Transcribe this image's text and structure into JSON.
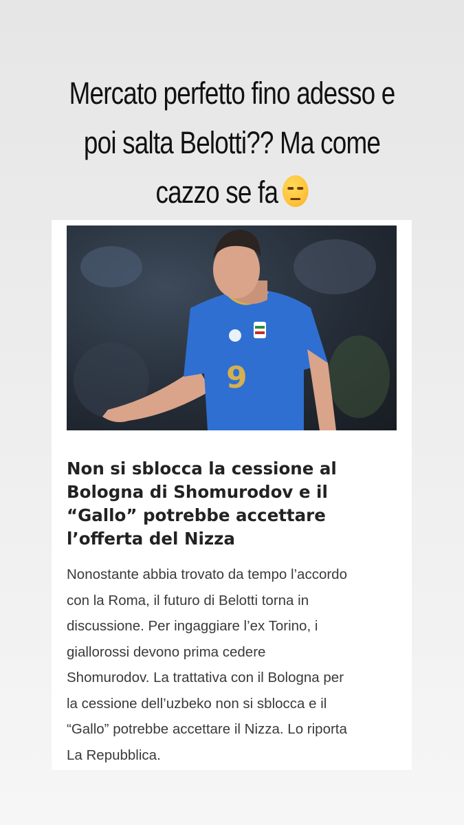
{
  "story": {
    "caption_lines": [
      "Mercato perfetto fino adesso e",
      "poi salta Belotti?? Ma come",
      "cazzo se fa"
    ],
    "caption_emoji": "unamused-face-emoji"
  },
  "article": {
    "image_description_icon": "player-photo",
    "jersey_number": "9",
    "headline_lines": [
      "Non si sblocca la cessione al",
      "Bologna di Shomurodov e il",
      "“Gallo” potrebbe accettare",
      "l’offerta del Nizza"
    ],
    "body_lines": [
      "Nonostante abbia trovato da tempo l’accordo",
      "con la Roma, il futuro di Belotti torna in",
      "discussione. Per ingaggiare l’ex Torino, i",
      "giallorossi devono prima cedere",
      "Shomurodov. La trattativa con il Bologna per",
      "la cessione dell’uzbeko non si sblocca e il",
      "“Gallo” potrebbe accettare il Nizza. Lo riporta",
      "La Repubblica."
    ]
  },
  "colors": {
    "background": "#ececec",
    "card": "#ffffff",
    "jersey": "#2f6fd1"
  }
}
